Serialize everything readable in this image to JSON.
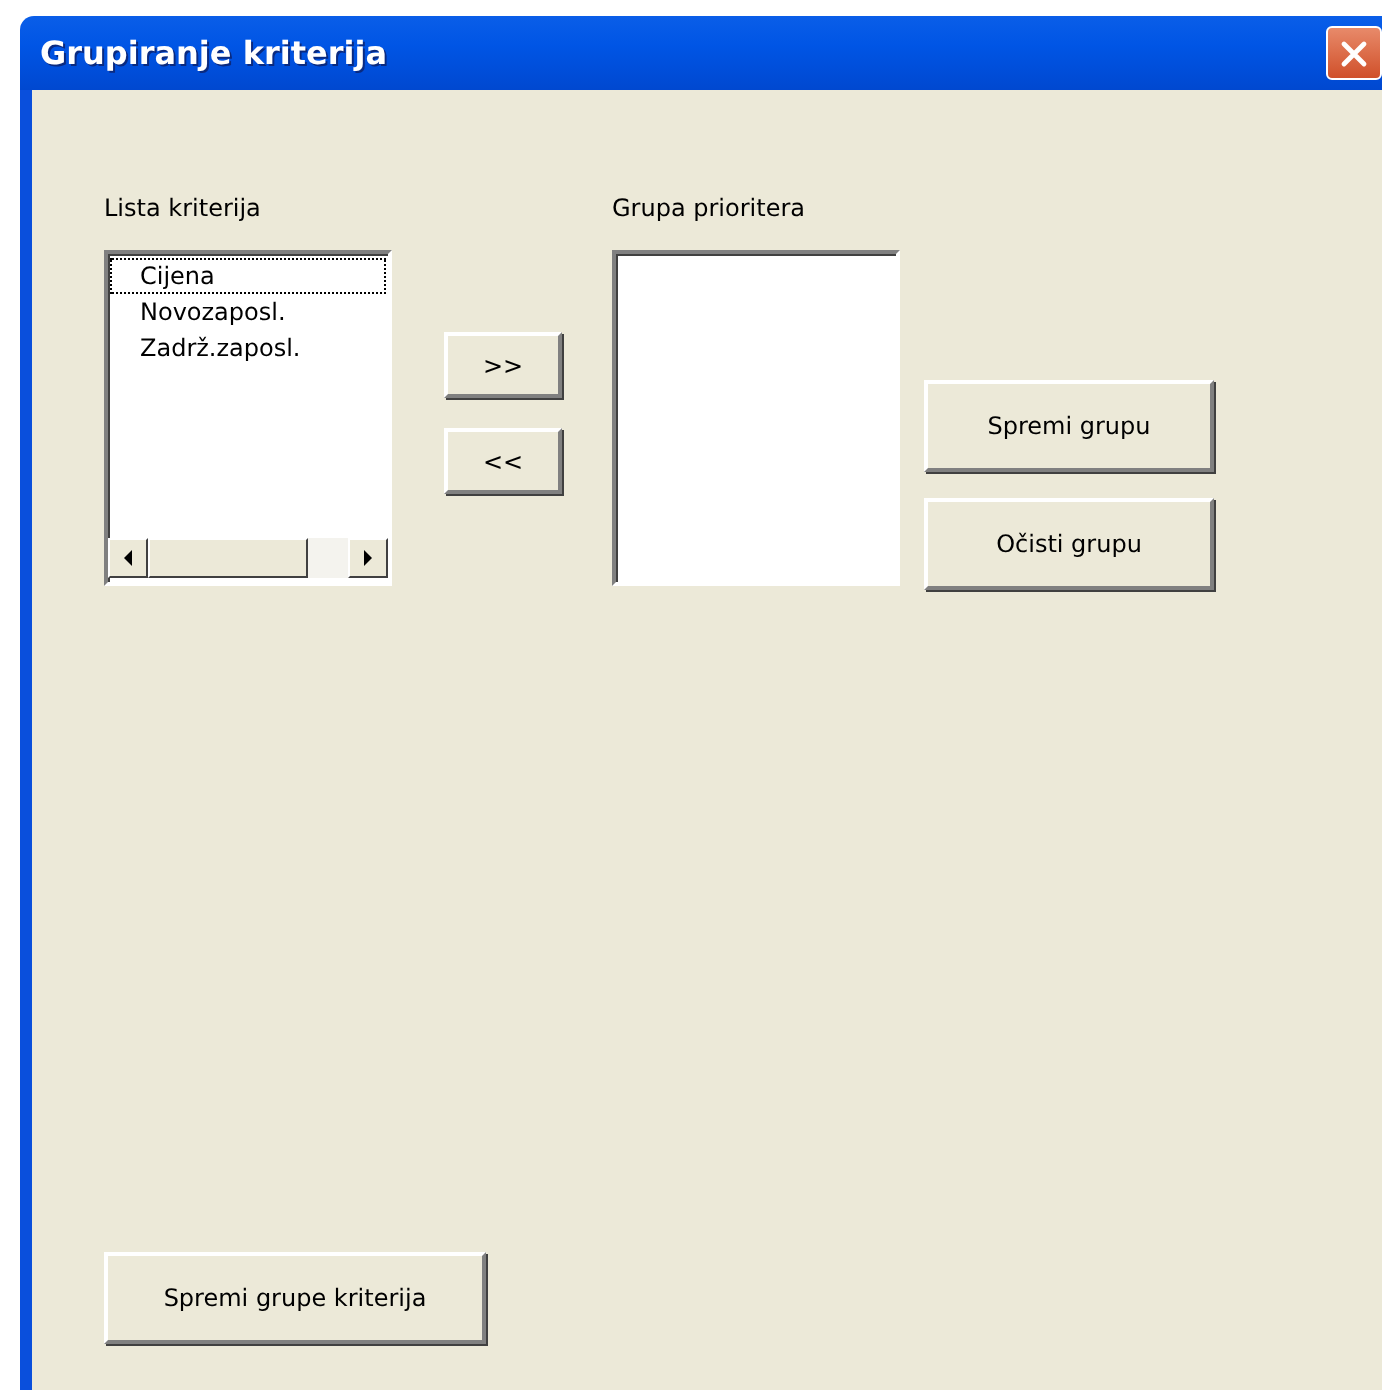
{
  "window": {
    "title": "Grupiranje kriterija"
  },
  "criteria_list": {
    "label": "Lista kriterija",
    "items": [
      {
        "text": "Cijena",
        "selected": true
      },
      {
        "text": "Novozaposl.",
        "selected": false
      },
      {
        "text": "Zadrž.zaposl.",
        "selected": false
      }
    ]
  },
  "move_buttons": [
    ">>",
    "<<"
  ],
  "priority_group": {
    "label": "Grupa prioritera"
  },
  "group_buttons": [
    "Spremi grupu",
    "Očisti grupu"
  ],
  "save_button": "Spremi grupe kriterija"
}
